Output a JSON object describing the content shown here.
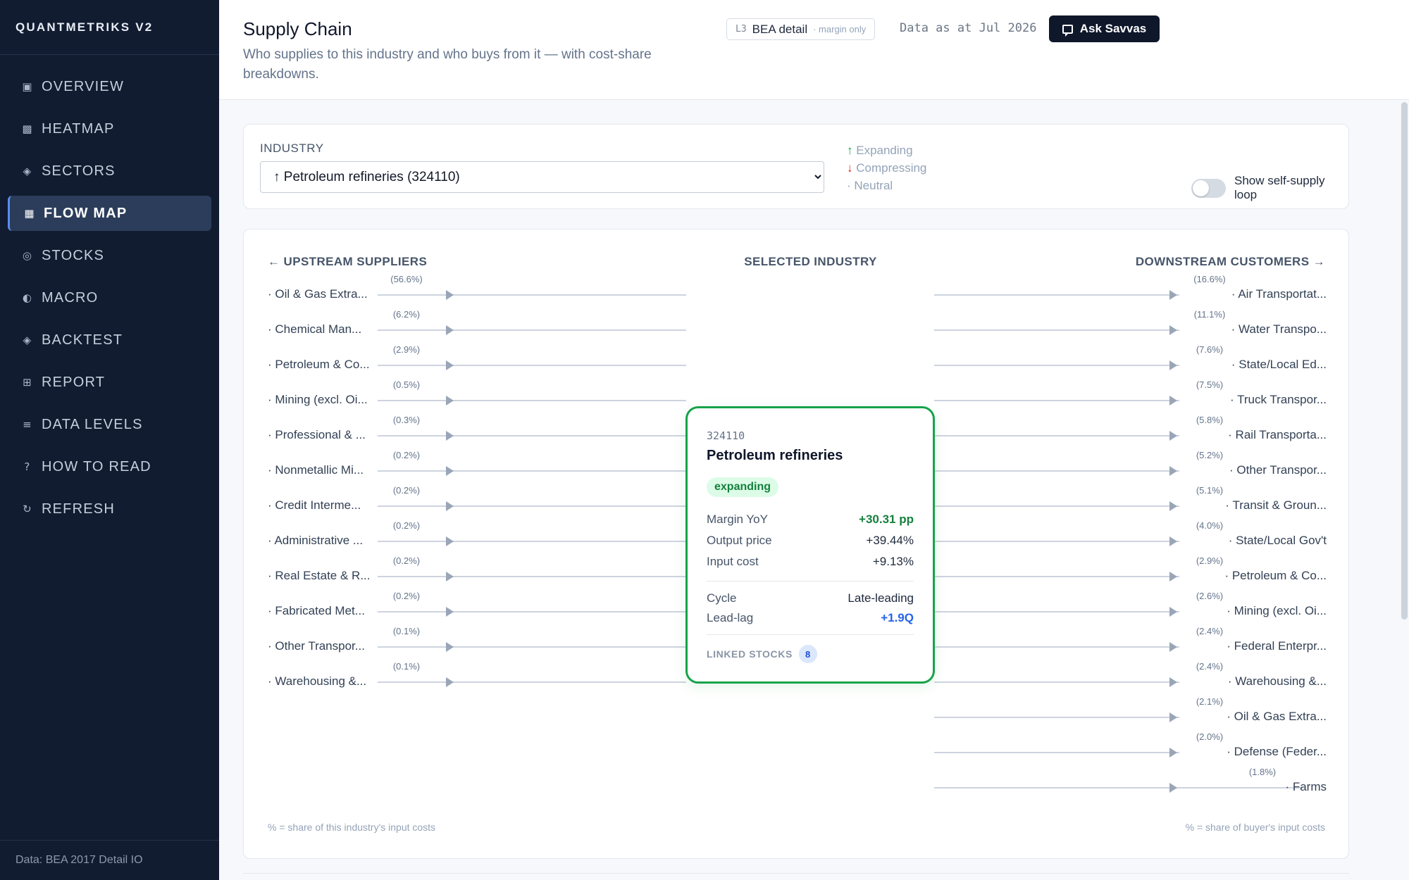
{
  "sidebar": {
    "brand": "QUANTMETRIKS V2",
    "items": [
      {
        "label": "OVERVIEW",
        "icon": "▣",
        "icon_name": "overview-icon",
        "active": false
      },
      {
        "label": "HEATMAP",
        "icon": "▩",
        "icon_name": "heatmap-icon",
        "active": false
      },
      {
        "label": "SECTORS",
        "icon": "◈",
        "icon_name": "sectors-icon",
        "active": false
      },
      {
        "label": "FLOW MAP",
        "icon": "▦",
        "icon_name": "flow-map-icon",
        "active": true
      },
      {
        "label": "STOCKS",
        "icon": "◎",
        "icon_name": "stocks-icon",
        "active": false
      },
      {
        "label": "MACRO",
        "icon": "◐",
        "icon_name": "macro-icon",
        "active": false
      },
      {
        "label": "BACKTEST",
        "icon": "◈",
        "icon_name": "backtest-icon",
        "active": false
      },
      {
        "label": "REPORT",
        "icon": "⊞",
        "icon_name": "report-icon",
        "active": false
      },
      {
        "label": "DATA LEVELS",
        "icon": "≡",
        "icon_name": "data-levels-icon",
        "active": false
      },
      {
        "label": "HOW TO READ",
        "icon": "?",
        "icon_name": "help-icon",
        "active": false
      },
      {
        "label": "REFRESH",
        "icon": "↻",
        "icon_name": "refresh-icon",
        "active": false
      }
    ],
    "footer": "Data: BEA 2017 Detail IO"
  },
  "header": {
    "title": "Supply Chain",
    "subtitle": "Who supplies to this industry and who buys from it — with cost-share breakdowns.",
    "level_code": "L3",
    "level_name": "BEA detail",
    "level_note": "· margin only",
    "as_of": "Data as at Jul 2026",
    "ask_button": "Ask Savvas"
  },
  "filter": {
    "label": "INDUSTRY",
    "selected": "↑ Petroleum refineries (324110)",
    "legend": {
      "expanding": "Expanding",
      "compressing": "Compressing",
      "neutral": "· Neutral"
    },
    "toggle_label": "Show self-supply loop",
    "toggle_on": false
  },
  "flow": {
    "upstream_heading": "← UPSTREAM SUPPLIERS",
    "center_heading": "SELECTED INDUSTRY",
    "downstream_heading": "DOWNSTREAM CUSTOMERS →",
    "upstream_footnote": "% = share of this industry's input costs",
    "downstream_footnote": "% = share of buyer's input costs",
    "upstream": [
      {
        "label": "· Oil & Gas Extra...",
        "pct": "(56.6%)"
      },
      {
        "label": "· Chemical Man...",
        "pct": "(6.2%)"
      },
      {
        "label": "· Petroleum & Co...",
        "pct": "(2.9%)"
      },
      {
        "label": "· Mining (excl. Oi...",
        "pct": "(0.5%)"
      },
      {
        "label": "· Professional & ...",
        "pct": "(0.3%)"
      },
      {
        "label": "· Nonmetallic Mi...",
        "pct": "(0.2%)"
      },
      {
        "label": "· Credit Interme...",
        "pct": "(0.2%)"
      },
      {
        "label": "· Administrative ...",
        "pct": "(0.2%)"
      },
      {
        "label": "· Real Estate & R...",
        "pct": "(0.2%)"
      },
      {
        "label": "· Fabricated Met...",
        "pct": "(0.2%)"
      },
      {
        "label": "· Other Transpor...",
        "pct": "(0.1%)"
      },
      {
        "label": "· Warehousing &...",
        "pct": "(0.1%)"
      }
    ],
    "downstream": [
      {
        "label": "· Air Transportat...",
        "pct": "(16.6%)"
      },
      {
        "label": "· Water Transpo...",
        "pct": "(11.1%)"
      },
      {
        "label": "· State/Local Ed...",
        "pct": "(7.6%)"
      },
      {
        "label": "· Truck Transpor...",
        "pct": "(7.5%)"
      },
      {
        "label": "· Rail Transporta...",
        "pct": "(5.8%)"
      },
      {
        "label": "· Other Transpor...",
        "pct": "(5.2%)"
      },
      {
        "label": "· Transit & Groun...",
        "pct": "(5.1%)"
      },
      {
        "label": "· State/Local Gov't",
        "pct": "(4.0%)"
      },
      {
        "label": "· Petroleum & Co...",
        "pct": "(2.9%)"
      },
      {
        "label": "· Mining (excl. Oi...",
        "pct": "(2.6%)"
      },
      {
        "label": "· Federal Enterpr...",
        "pct": "(2.4%)"
      },
      {
        "label": "· Warehousing &...",
        "pct": "(2.4%)"
      },
      {
        "label": "· Oil & Gas Extra...",
        "pct": "(2.1%)"
      },
      {
        "label": "· Defense (Feder...",
        "pct": "(2.0%)"
      },
      {
        "label": "· Farms",
        "pct": "(1.8%)"
      }
    ],
    "node": {
      "code": "324110",
      "name": "Petroleum refineries",
      "badge": "expanding",
      "margin_label": "Margin YoY",
      "margin_value": "+30.31 pp",
      "output_label": "Output price",
      "output_value": "+39.44%",
      "input_label": "Input cost",
      "input_value": "+9.13%",
      "cycle_label": "Cycle",
      "cycle_value": "Late-leading",
      "leadlag_label": "Lead-lag",
      "leadlag_value": "+1.9Q",
      "linked_label": "LINKED STOCKS",
      "linked_count": "8"
    }
  }
}
